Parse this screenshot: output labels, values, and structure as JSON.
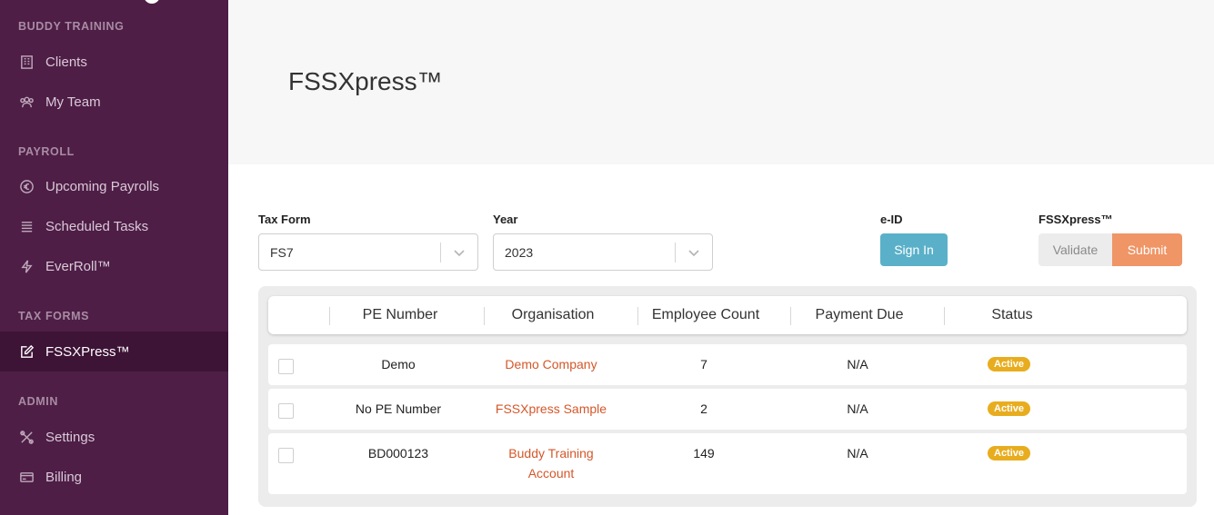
{
  "sidebar": {
    "sections": [
      {
        "title": "BUDDY TRAINING"
      },
      {
        "title": "PAYROLL"
      },
      {
        "title": "TAX FORMS"
      },
      {
        "title": "ADMIN"
      }
    ],
    "items": [
      {
        "label": "Clients",
        "icon": "building-icon"
      },
      {
        "label": "My Team",
        "icon": "team-icon"
      },
      {
        "label": "Upcoming Payrolls",
        "icon": "euro-icon"
      },
      {
        "label": "Scheduled Tasks",
        "icon": "list-icon"
      },
      {
        "label": "EverRoll™",
        "icon": "lightning-icon"
      },
      {
        "label": "FSSXPress™",
        "icon": "edit-icon",
        "active": true
      },
      {
        "label": "Settings",
        "icon": "tools-icon"
      },
      {
        "label": "Billing",
        "icon": "card-icon"
      }
    ]
  },
  "header": {
    "title": "FSSXpress™"
  },
  "form": {
    "tax_form_label": "Tax Form",
    "tax_form_value": "FS7",
    "year_label": "Year",
    "year_value": "2023",
    "eid_label": "e-ID",
    "signin_label": "Sign In",
    "fssxpress_label": "FSSXpress™",
    "validate_label": "Validate",
    "submit_label": "Submit"
  },
  "table": {
    "columns": [
      "PE Number",
      "Organisation",
      "Employee Count",
      "Payment Due",
      "Status"
    ],
    "rows": [
      {
        "pe_number": "Demo",
        "organisation": "Demo Company",
        "organisation_line2": "",
        "employee_count": "7",
        "payment_due": "N/A",
        "status": "Active"
      },
      {
        "pe_number": "No PE Number",
        "organisation": "FSSXpress Sample",
        "organisation_line2": "",
        "employee_count": "2",
        "payment_due": "N/A",
        "status": "Active"
      },
      {
        "pe_number": "BD000123",
        "organisation": "Buddy Training",
        "organisation_line2": "Account",
        "employee_count": "149",
        "payment_due": "N/A",
        "status": "Active"
      }
    ]
  },
  "colors": {
    "sidebar_bg": "#4e1e47",
    "accent_orange": "#ef9566",
    "link": "#d4572a",
    "badge": "#e8ad1f",
    "signin": "#5ab0c8"
  }
}
